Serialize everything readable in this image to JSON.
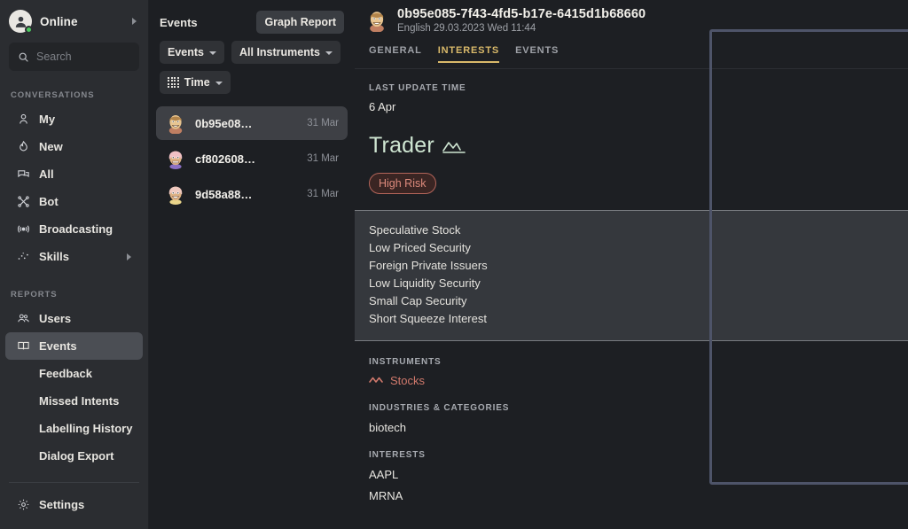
{
  "sidebar": {
    "profile": {
      "name": "Online",
      "status_color": "#4bc95e",
      "avatar_icon": "user-avatar-icon",
      "expand_icon": "caret-right-icon"
    },
    "search": {
      "placeholder": "Search",
      "value": "",
      "icon": "search-icon"
    },
    "conversations_label": "CONVERSATIONS",
    "conversations": [
      {
        "label": "My",
        "icon": "person-icon"
      },
      {
        "label": "New",
        "icon": "flame-icon"
      },
      {
        "label": "All",
        "icon": "chat-bubbles-icon"
      },
      {
        "label": "Bot",
        "icon": "bot-node-icon"
      },
      {
        "label": "Broadcasting",
        "icon": "broadcast-icon"
      },
      {
        "label": "Skills",
        "icon": "sparkle-dots-icon",
        "has_chevron": true
      }
    ],
    "reports_label": "REPORTS",
    "reports": [
      {
        "label": "Users",
        "icon": "people-icon",
        "active": false,
        "sub": false
      },
      {
        "label": "Events",
        "icon": "book-icon",
        "active": true,
        "sub": false
      },
      {
        "label": "Feedback",
        "icon": "",
        "active": false,
        "sub": true
      },
      {
        "label": "Missed Intents",
        "icon": "",
        "active": false,
        "sub": true
      },
      {
        "label": "Labelling History",
        "icon": "",
        "active": false,
        "sub": true
      },
      {
        "label": "Dialog Export",
        "icon": "",
        "active": false,
        "sub": true
      }
    ],
    "settings": {
      "label": "Settings",
      "icon": "gear-icon"
    }
  },
  "events": {
    "title": "Events",
    "graph_report_label": "Graph Report",
    "filters": [
      {
        "label": "Events",
        "icon": "",
        "chevron": true
      },
      {
        "label": "All Instruments",
        "icon": "",
        "chevron": true
      },
      {
        "label": "Time",
        "icon": "grid-dots-icon",
        "chevron": true
      }
    ],
    "list": [
      {
        "name": "0b95e08…",
        "date": "31 Mar",
        "selected": true
      },
      {
        "name": "cf802608…",
        "date": "31 Mar",
        "selected": false
      },
      {
        "name": "9d58a88…",
        "date": "31 Mar",
        "selected": false
      }
    ]
  },
  "detail": {
    "header": {
      "id": "0b95e085-7f43-4fd5-b17e-6415d1b68660",
      "subtitle": "English 29.03.2023 Wed 11:44",
      "avatar_icon": "user-face-avatar"
    },
    "tabs": [
      {
        "label": "GENERAL",
        "active": false
      },
      {
        "label": "INTERESTS",
        "active": true
      },
      {
        "label": "EVENTS",
        "active": false
      }
    ],
    "last_update_label": "LAST UPDATE TIME",
    "last_update_value": "6 Apr",
    "persona": {
      "name": "Trader",
      "icon": "trend-line-icon",
      "color": "#cfe6d2"
    },
    "risk_badge": {
      "label": "High Risk",
      "color": "#dd8a7c",
      "bg": "#3a2523",
      "border": "#b4655a"
    },
    "interest_tags": [
      "Speculative Stock",
      "Low Priced Security",
      "Foreign Private Issuers",
      "Low Liquidity Security",
      "Small Cap Security",
      "Short Squeeze Interest"
    ],
    "instruments_label": "INSTRUMENTS",
    "instruments": [
      {
        "label": "Stocks",
        "icon": "trend-line-icon",
        "color": "#d0796c"
      }
    ],
    "industries_label": "INDUSTRIES & CATEGORIES",
    "industries": [
      "biotech"
    ],
    "interests_label": "INTERESTS",
    "interests": [
      "AAPL",
      "MRNA"
    ]
  },
  "accents": {
    "tab_active": "#d9b96a",
    "highlight_border": "#4e5469",
    "selection_bg": "#3e4045"
  }
}
